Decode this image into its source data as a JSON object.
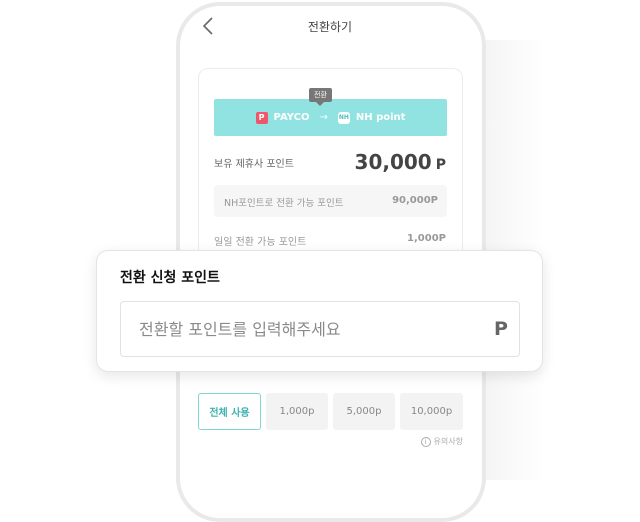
{
  "header": {
    "title": "전환하기"
  },
  "banner": {
    "tag": "전환",
    "from_badge": "P",
    "from_label": "PAYCO",
    "arrow": "→",
    "to_badge": "NH",
    "to_label": "NH point"
  },
  "balance": {
    "label": "보유 제휴사 포인트",
    "value": "30,000",
    "unit": "P"
  },
  "convertible": {
    "label": "NH포인트로 전환 가능 포인트",
    "value": "90,000P"
  },
  "daily": {
    "label": "일일 전환 가능 포인트",
    "value": "1,000P"
  },
  "popup": {
    "title": "전환 신청 포인트",
    "placeholder": "전환할 포인트를 입력해주세요",
    "unit": "P"
  },
  "amount_buttons": [
    "전체 사용",
    "1,000p",
    "5,000p",
    "10,000p"
  ],
  "notice": {
    "icon": "i",
    "label": "유의사항"
  },
  "colors": {
    "accent": "#90e3e1",
    "payco": "#f0566b",
    "accent_text": "#3bb3b0"
  },
  "icons": {
    "back": "chevron-left-icon",
    "info": "info-icon"
  }
}
